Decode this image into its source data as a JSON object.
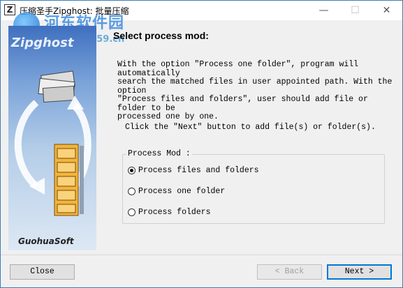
{
  "window": {
    "title": "压缩圣手Zipghost: 批量压缩",
    "icon_letter": "Z"
  },
  "watermark": {
    "text": "河东软件园",
    "url": "www.pc0359.cn"
  },
  "sidepanel": {
    "logo_text": "Zipghost",
    "footer_text": "GuohuaSoft"
  },
  "main": {
    "heading": "Select process mod:",
    "description": "With the option \"Process one folder\", program will automatically\nsearch the matched files in user appointed path. With the option\n\"Process files and folders\", user should add file or folder to be\nprocessed one by one.",
    "hint": "Click the \"Next\" button to add file(s) or folder(s).",
    "group_label": "Process Mod :",
    "options": [
      {
        "label": "Process files and folders",
        "checked": true
      },
      {
        "label": "Process one folder",
        "checked": false
      },
      {
        "label": "Process folders",
        "checked": false
      }
    ]
  },
  "footer": {
    "close_label": "Close",
    "back_label": "< Back",
    "next_label": "Next >"
  }
}
